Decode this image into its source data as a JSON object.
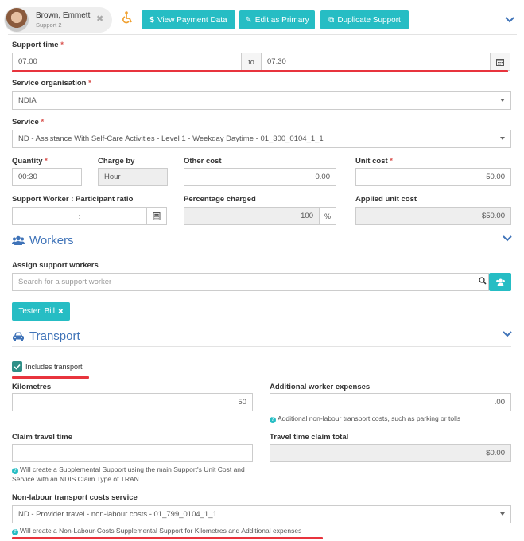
{
  "participant": {
    "name": "Brown, Emmett",
    "sub": "Support 2"
  },
  "header": {
    "view_payment": "View Payment Data",
    "edit_primary": "Edit as Primary",
    "duplicate": "Duplicate Support"
  },
  "support_time": {
    "label": "Support time",
    "from": "07:00",
    "to_label": "to",
    "to": "07:30"
  },
  "service_org": {
    "label": "Service organisation",
    "value": "NDIA"
  },
  "service": {
    "label": "Service",
    "value": "ND - Assistance With Self-Care Activities - Level 1 - Weekday Daytime - 01_300_0104_1_1"
  },
  "quantity": {
    "label": "Quantity",
    "value": "00:30"
  },
  "charge_by": {
    "label": "Charge by",
    "value": "Hour"
  },
  "other_cost": {
    "label": "Other cost",
    "value": "0.00"
  },
  "unit_cost": {
    "label": "Unit cost",
    "value": "50.00"
  },
  "ratio": {
    "label": "Support Worker : Participant ratio",
    "sep": ":"
  },
  "percentage": {
    "label": "Percentage charged",
    "value": "100",
    "unit": "%"
  },
  "applied_unit_cost": {
    "label": "Applied unit cost",
    "value": "$50.00"
  },
  "workers": {
    "title": "Workers",
    "assign_label": "Assign support workers",
    "search_placeholder": "Search for a support worker",
    "tag": "Tester, Bill"
  },
  "transport": {
    "title": "Transport",
    "includes_label": "Includes transport",
    "km_label": "Kilometres",
    "km_value": "50",
    "add_exp_label": "Additional worker expenses",
    "add_exp_value": ".00",
    "add_exp_hint": "Additional non-labour transport costs, such as parking or tolls",
    "claim_label": "Claim travel time",
    "claim_hint": "Will create a Supplemental Support using the main Support's Unit Cost and Service with an NDIS Claim Type of TRAN",
    "travel_total_label": "Travel time claim total",
    "travel_total_value": "$0.00",
    "nonlabour_label": "Non-labour transport costs service",
    "nonlabour_value": "ND - Provider travel - non-labour costs - 01_799_0104_1_1",
    "nonlabour_hint": "Will create a Non-Labour-Costs Supplemental Support for Kilometres and Additional expenses"
  },
  "colors": {
    "accent": "#26bdc4",
    "section": "#3f73b8",
    "highlight": "#e8343d"
  }
}
